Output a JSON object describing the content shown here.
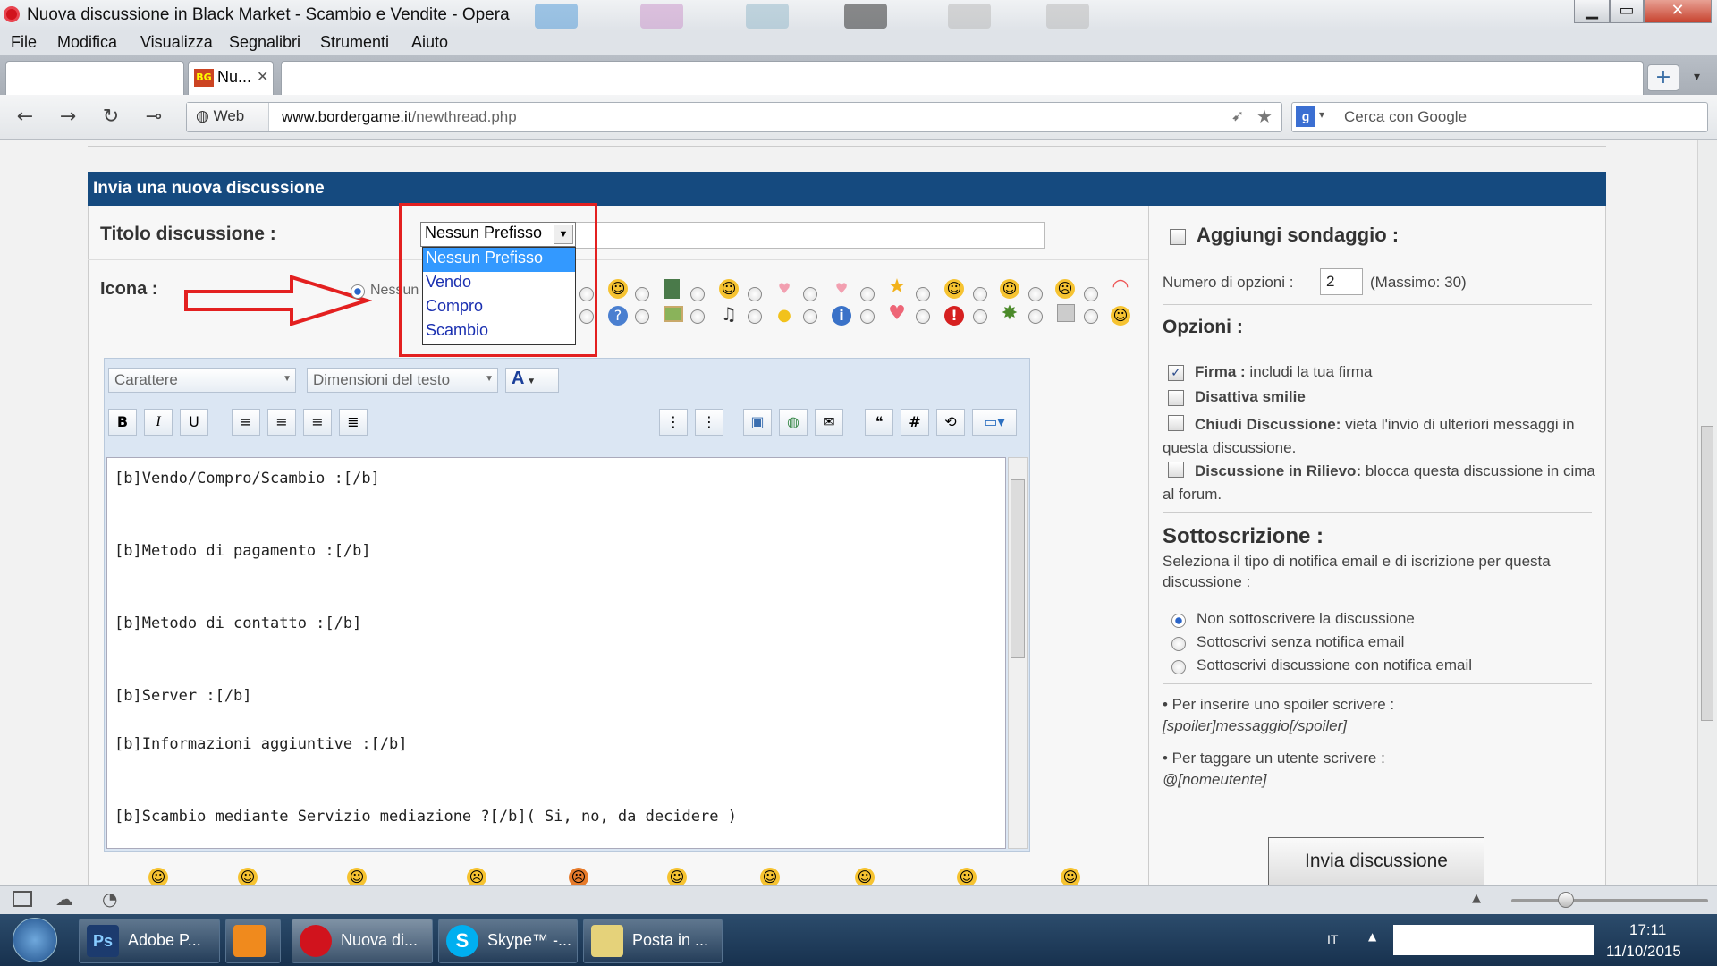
{
  "window": {
    "title": "Nuova discussione in Black Market - Scambio e Vendite - Opera",
    "minimize": "▁",
    "maximize": "▭",
    "close": "✕"
  },
  "menu": [
    "File",
    "Modifica",
    "Visualizza",
    "Segnalibri",
    "Strumenti",
    "Aiuto"
  ],
  "tabs": {
    "active_label": "Nu...",
    "active_close": "✕",
    "new_tab": "+"
  },
  "address": {
    "web_label": "Web",
    "url_domain": "www.bordergame.it",
    "url_path": "/newthread.php",
    "search_placeholder": "Cerca con Google"
  },
  "form": {
    "header": "Invia una nuova discussione",
    "title_label": "Titolo discussione :",
    "icon_label": "Icona :",
    "none_icon_text": "Nessun",
    "prefix": {
      "selected": "Nessun Prefisso",
      "options": [
        "Nessun Prefisso",
        "Vendo",
        "Compro",
        "Scambio"
      ]
    },
    "font_select": "Carattere",
    "size_select": "Dimensioni del testo",
    "toolbar": {
      "bold": "B",
      "italic": "I",
      "underline": "U",
      "hash": "#"
    },
    "editor_lines": [
      "[b]Vendo/Compro/Scambio :[/b]",
      "",
      "",
      "[b]Metodo di pagamento :[/b]",
      "",
      "",
      "[b]Metodo di contatto :[/b]",
      "",
      "",
      "[b]Server :[/b]",
      "",
      "[b]Informazioni aggiuntive :[/b]",
      "",
      "",
      "[b]Scambio mediante Servizio mediazione ?[/b]( Si, no, da decidere )"
    ]
  },
  "sidebar": {
    "poll_label": "Aggiungi sondaggio :",
    "options_count_label": "Numero di opzioni :",
    "options_count_value": "2",
    "options_max": "(Massimo: 30)",
    "options_heading": "Opzioni :",
    "signature": {
      "bold": "Firma :",
      "text": "includi la tua firma",
      "checked": true
    },
    "disable_smilies": {
      "bold": "Disattiva smilie"
    },
    "close_thread": {
      "bold": "Chiudi Discussione:",
      "text": "vieta l'invio di ulteriori messaggi in questa discussione."
    },
    "sticky": {
      "bold": "Discussione in Rilievo:",
      "text": "blocca questa discussione in cima al forum."
    },
    "subscription_heading": "Sottoscrizione :",
    "subscription_text": "Seleziona il tipo di notifica email e di iscrizione per questa discussione :",
    "subscription_options": [
      "Non sottoscrivere la discussione",
      "Sottoscrivi senza notifica email",
      "Sottoscrivi discussione con notifica email"
    ],
    "spoiler_hint": "• Per inserire uno spoiler scrivere :",
    "spoiler_code": "[spoiler]messaggio[/spoiler]",
    "tag_hint": "• Per taggare un utente scrivere :",
    "tag_code": "@[nomeutente]",
    "submit": "Invia discussione"
  },
  "taskbar": {
    "items": [
      "Adobe P...",
      "",
      "Nuova di...",
      "Skype™ -...",
      "Posta in ..."
    ],
    "lang": "IT",
    "time": "17:11",
    "date": "11/10/2015"
  },
  "colors": {
    "header_blue": "#154a7f",
    "highlight": "#3399ff",
    "annotation_red": "#e32020"
  }
}
